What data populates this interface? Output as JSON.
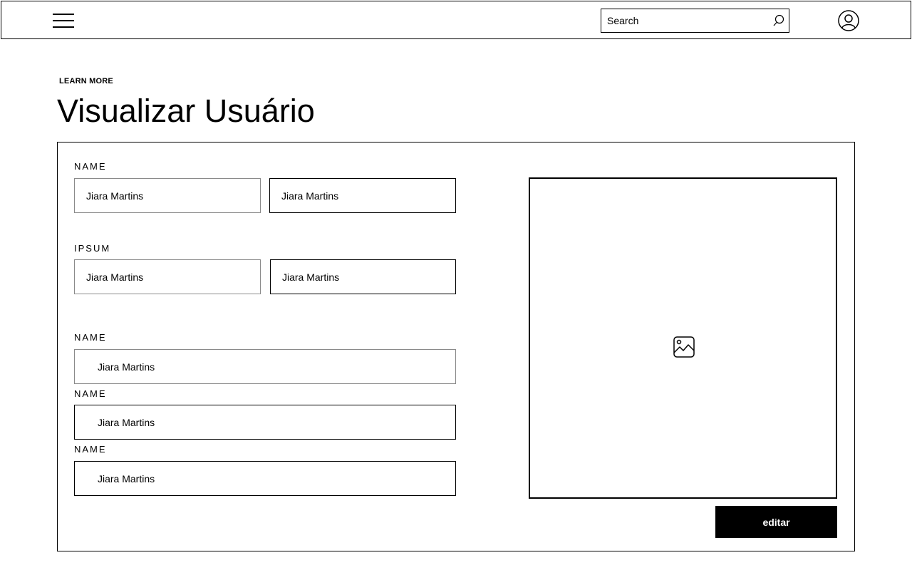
{
  "header": {
    "menu_icon": "hamburger-menu-icon",
    "search": {
      "placeholder": "Search",
      "value": "",
      "icon": "search-icon"
    },
    "avatar_icon": "user-avatar-icon"
  },
  "hero": {
    "eyebrow": "LEARN MORE",
    "title": "Visualizar Usuário"
  },
  "form": {
    "group1": {
      "label": "NAME",
      "field_a": "Jiara Martins",
      "field_b": "Jiara Martins"
    },
    "group2": {
      "label": "IPSUM",
      "field_a": "Jiara Martins",
      "field_b": "Jiara Martins"
    },
    "group3": {
      "label": "NAME",
      "value": "Jiara Martins"
    },
    "group4": {
      "label": "NAME",
      "value": "Jiara Martins"
    },
    "group5": {
      "label": "NAME",
      "value": "Jiara Martins"
    }
  },
  "image_placeholder": {
    "icon": "image-icon"
  },
  "actions": {
    "edit_label": "editar"
  },
  "colors": {
    "primary": "#000000",
    "background": "#ffffff",
    "button_text": "#ffffff"
  }
}
